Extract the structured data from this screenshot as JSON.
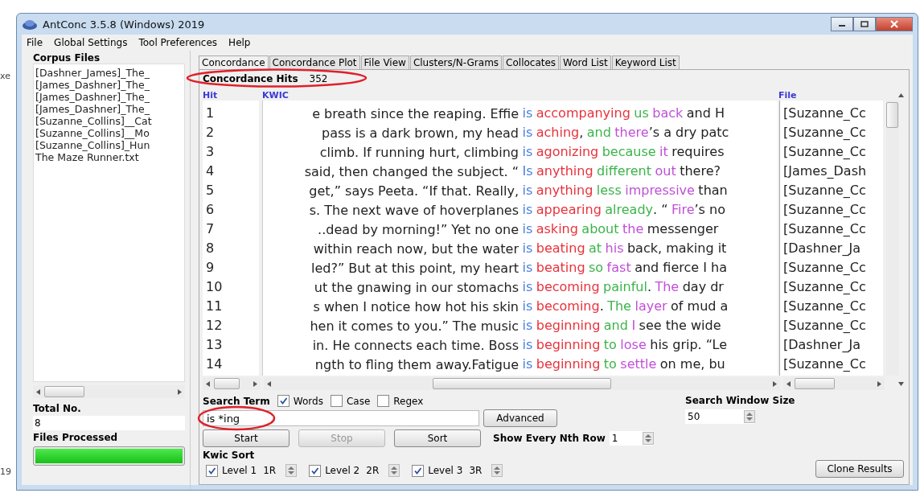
{
  "background_fragments": [
    "xe",
    "19"
  ],
  "window": {
    "title": "AntConc 3.5.8 (Windows) 2019"
  },
  "menu": [
    "File",
    "Global Settings",
    "Tool Preferences",
    "Help"
  ],
  "corpus_files": {
    "label": "Corpus Files",
    "items": [
      "[Dashner_James]_The_",
      "[James_Dashner]_The_",
      "[James_Dashner]_The_",
      "[James_Dashner]_The_",
      "[Suzanne_Collins]__Cat",
      "[Suzanne_Collins]__Mo",
      "[Suzanne_Collins]_Hun",
      "The Maze Runner.txt"
    ]
  },
  "total": {
    "label": "Total No.",
    "value": "8"
  },
  "files_processed": {
    "label": "Files Processed",
    "level": 1
  },
  "tabs": [
    {
      "label": "Concordance",
      "selected": true
    },
    {
      "label": "Concordance Plot",
      "selected": false
    },
    {
      "label": "File View",
      "selected": false
    },
    {
      "label": "Clusters/N-Grams",
      "selected": false
    },
    {
      "label": "Collocates",
      "selected": false
    },
    {
      "label": "Word List",
      "selected": false
    },
    {
      "label": "Keyword List",
      "selected": false
    }
  ],
  "hits": {
    "label": "Concordance Hits",
    "value": "352"
  },
  "columns": [
    "Hit",
    "KWIC",
    "File"
  ],
  "rows": [
    {
      "hit": "1",
      "left": "e breath since the reaping. Effie",
      "right": [
        {
          "kind": "node",
          "text": "is"
        },
        {
          "kind": "l1",
          "text": "accompanying"
        },
        {
          "kind": "l2",
          "text": "us"
        },
        {
          "kind": "l3",
          "text": "back"
        },
        {
          "kind": "plain",
          "text": "and H"
        }
      ],
      "file": "[Suzanne_Cc"
    },
    {
      "hit": "2",
      "left": "pass is a dark brown, my head",
      "right": [
        {
          "kind": "node",
          "text": "is"
        },
        {
          "kind": "l1",
          "text": "aching",
          "tail": ","
        },
        {
          "kind": "l2",
          "text": "and"
        },
        {
          "kind": "l3",
          "text": "there"
        },
        {
          "kind": "punct",
          "text": "’s a dry patc"
        }
      ],
      "file": "[Suzanne_Cc"
    },
    {
      "hit": "3",
      "left": "climb. If running hurt, climbing",
      "right": [
        {
          "kind": "node",
          "text": "is"
        },
        {
          "kind": "l1",
          "text": "agonizing"
        },
        {
          "kind": "l2",
          "text": "because"
        },
        {
          "kind": "l3",
          "text": "it"
        },
        {
          "kind": "plain",
          "text": "requires"
        }
      ],
      "file": "[Suzanne_Cc"
    },
    {
      "hit": "4",
      "left": "said, then changed the subject. “",
      "right": [
        {
          "kind": "node",
          "text": "Is"
        },
        {
          "kind": "l1",
          "text": "anything"
        },
        {
          "kind": "l2",
          "text": "different"
        },
        {
          "kind": "l3",
          "text": "out"
        },
        {
          "kind": "plain",
          "text": "there?"
        }
      ],
      "file": "[James_Dash"
    },
    {
      "hit": "5",
      "left": "get,” says Peeta. “If that. Really,",
      "right": [
        {
          "kind": "node",
          "text": "is"
        },
        {
          "kind": "l1",
          "text": "anything"
        },
        {
          "kind": "l2",
          "text": "less"
        },
        {
          "kind": "l3",
          "text": "impressive"
        },
        {
          "kind": "plain",
          "text": "than"
        }
      ],
      "file": "[Suzanne_Cc"
    },
    {
      "hit": "6",
      "left": "s. The next wave of hoverplanes",
      "right": [
        {
          "kind": "node",
          "text": "is"
        },
        {
          "kind": "l1",
          "text": "appearing"
        },
        {
          "kind": "l2",
          "text": "already"
        },
        {
          "kind": "punct",
          "text": ". “"
        },
        {
          "kind": "l3",
          "text": "Fire"
        },
        {
          "kind": "punct",
          "text": "’s no"
        }
      ],
      "file": "[Suzanne_Cc"
    },
    {
      "hit": "7",
      "left": "..dead by morning!” Yet no one",
      "right": [
        {
          "kind": "node",
          "text": "is"
        },
        {
          "kind": "l1",
          "text": "asking"
        },
        {
          "kind": "l2",
          "text": "about"
        },
        {
          "kind": "l3",
          "text": "the"
        },
        {
          "kind": "plain",
          "text": "messenger"
        }
      ],
      "file": "[Suzanne_Cc"
    },
    {
      "hit": "8",
      "left": "within reach now, but the water",
      "right": [
        {
          "kind": "node",
          "text": "is"
        },
        {
          "kind": "l1",
          "text": "beating"
        },
        {
          "kind": "l2",
          "text": "at"
        },
        {
          "kind": "l3",
          "text": "his"
        },
        {
          "kind": "plain",
          "text": "back, making it"
        }
      ],
      "file": "[Dashner_Ja"
    },
    {
      "hit": "9",
      "left": "led?” But at this point, my heart",
      "right": [
        {
          "kind": "node",
          "text": "is"
        },
        {
          "kind": "l1",
          "text": "beating"
        },
        {
          "kind": "l2",
          "text": "so"
        },
        {
          "kind": "l3",
          "text": "fast"
        },
        {
          "kind": "plain",
          "text": "and fierce I ha"
        }
      ],
      "file": "[Suzanne_Cc"
    },
    {
      "hit": "10",
      "left": "ut the gnawing in our stomachs",
      "right": [
        {
          "kind": "node",
          "text": "is"
        },
        {
          "kind": "l1",
          "text": "becoming"
        },
        {
          "kind": "l2",
          "text": "painful",
          "tail": "."
        },
        {
          "kind": "l3",
          "text": "The"
        },
        {
          "kind": "plain",
          "text": "day dr"
        }
      ],
      "file": "[Suzanne_Cc"
    },
    {
      "hit": "11",
      "left": "s when I notice how hot his skin",
      "right": [
        {
          "kind": "node",
          "text": "is"
        },
        {
          "kind": "l1",
          "text": "becoming",
          "tail": "."
        },
        {
          "kind": "l2",
          "text": "The"
        },
        {
          "kind": "l3",
          "text": "layer"
        },
        {
          "kind": "plain",
          "text": "of mud a"
        }
      ],
      "file": "[Suzanne_Cc"
    },
    {
      "hit": "12",
      "left": "hen it comes to you.” The music",
      "right": [
        {
          "kind": "node",
          "text": "is"
        },
        {
          "kind": "l1",
          "text": "beginning"
        },
        {
          "kind": "l2",
          "text": "and"
        },
        {
          "kind": "l3",
          "text": "I"
        },
        {
          "kind": "plain",
          "text": "see the wide"
        }
      ],
      "file": "[Suzanne_Cc"
    },
    {
      "hit": "13",
      "left": "in. He connects each time. Boss",
      "right": [
        {
          "kind": "node",
          "text": "is"
        },
        {
          "kind": "l1",
          "text": "beginning"
        },
        {
          "kind": "l2",
          "text": "to"
        },
        {
          "kind": "l3",
          "text": "lose"
        },
        {
          "kind": "plain",
          "text": "his grip. “Le"
        }
      ],
      "file": "[Dashner_Ja"
    },
    {
      "hit": "14",
      "left": "ngth to fling them away.Fatigue",
      "right": [
        {
          "kind": "node",
          "text": "is"
        },
        {
          "kind": "l1",
          "text": "beginning"
        },
        {
          "kind": "l2",
          "text": "to"
        },
        {
          "kind": "l3",
          "text": "settle"
        },
        {
          "kind": "plain",
          "text": "on me, bu"
        }
      ],
      "file": "[Suzanne_Cc"
    }
  ],
  "search": {
    "label": "Search Term",
    "options": [
      {
        "label": "Words",
        "checked": true
      },
      {
        "label": "Case",
        "checked": false
      },
      {
        "label": "Regex",
        "checked": false
      }
    ],
    "value": "is *ing",
    "advanced": "Advanced"
  },
  "buttons": [
    {
      "label": "Start",
      "disabled": false
    },
    {
      "label": "Stop",
      "disabled": true
    },
    {
      "label": "Sort",
      "disabled": false
    }
  ],
  "nth_row": {
    "label": "Show Every Nth Row",
    "value": "1"
  },
  "window_size": {
    "label": "Search Window Size",
    "value": "50"
  },
  "kwic_sort": {
    "label": "Kwic Sort",
    "levels": [
      {
        "label": "Level 1",
        "checked": true,
        "value": "1R"
      },
      {
        "label": "Level 2",
        "checked": true,
        "value": "2R"
      },
      {
        "label": "Level 3",
        "checked": true,
        "value": "3R"
      }
    ]
  },
  "clone": "Clone Results"
}
